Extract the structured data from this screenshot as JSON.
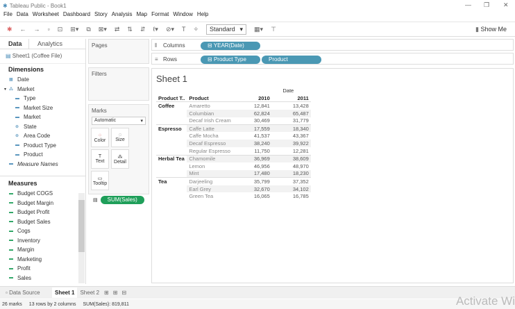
{
  "window": {
    "title": "Tableau Public - Book1"
  },
  "menu": [
    "File",
    "Data",
    "Worksheet",
    "Dashboard",
    "Story",
    "Analysis",
    "Map",
    "Format",
    "Window",
    "Help"
  ],
  "toolbar": {
    "fit": "Standard",
    "show_me": "Show Me"
  },
  "left": {
    "tabs": [
      "Data",
      "Analytics"
    ],
    "datasource": "Sheet1 (Coffee File)",
    "dimensions_label": "Dimensions",
    "dimensions": [
      {
        "n": "Date",
        "i": "cal"
      },
      {
        "n": "Market",
        "i": "hier"
      },
      {
        "n": "Type",
        "i": "abc"
      },
      {
        "n": "Market Size",
        "i": "abc"
      },
      {
        "n": "Market",
        "i": "abc"
      },
      {
        "n": "State",
        "i": "geo"
      },
      {
        "n": "Area Code",
        "i": "geo"
      },
      {
        "n": "Product Type",
        "i": "abc"
      },
      {
        "n": "Product",
        "i": "abc"
      }
    ],
    "measure_names": "Measure Names",
    "measures_label": "Measures",
    "measures": [
      "Budget COGS",
      "Budget Margin",
      "Budget Profit",
      "Budget Sales",
      "Cogs",
      "Inventory",
      "Margin",
      "Marketing",
      "Profit",
      "Sales"
    ]
  },
  "cards": {
    "pages": "Pages",
    "filters": "Filters",
    "marks": "Marks",
    "mark_type": "Automatic",
    "buttons": [
      "Color",
      "Size",
      "Text",
      "Detail",
      "Tooltip"
    ],
    "sum_pill": "SUM(Sales)"
  },
  "shelves": {
    "columns_label": "Columns",
    "rows_label": "Rows",
    "columns": [
      "YEAR(Date)"
    ],
    "rows": [
      "Product Type",
      "Product"
    ]
  },
  "sheet": {
    "title": "Sheet 1",
    "date_header": "Date",
    "col_headers": [
      "Product T..",
      "Product",
      "2010",
      "2011"
    ],
    "rows": [
      {
        "pt": "Coffee",
        "p": "Amaretto",
        "v": [
          "12,841",
          "13,428"
        ]
      },
      {
        "pt": "",
        "p": "Columbian",
        "v": [
          "62,824",
          "65,487"
        ]
      },
      {
        "pt": "",
        "p": "Decaf Irish Cream",
        "v": [
          "30,469",
          "31,779"
        ]
      },
      {
        "pt": "Espresso",
        "p": "Caffe Latte",
        "v": [
          "17,559",
          "18,340"
        ]
      },
      {
        "pt": "",
        "p": "Caffe Mocha",
        "v": [
          "41,537",
          "43,367"
        ]
      },
      {
        "pt": "",
        "p": "Decaf Espresso",
        "v": [
          "38,240",
          "39,922"
        ]
      },
      {
        "pt": "",
        "p": "Regular Espresso",
        "v": [
          "11,750",
          "12,281"
        ]
      },
      {
        "pt": "Herbal Tea",
        "p": "Chamomile",
        "v": [
          "36,969",
          "38,609"
        ]
      },
      {
        "pt": "",
        "p": "Lemon",
        "v": [
          "46,956",
          "48,970"
        ]
      },
      {
        "pt": "",
        "p": "Mint",
        "v": [
          "17,480",
          "18,230"
        ]
      },
      {
        "pt": "Tea",
        "p": "Darjeeling",
        "v": [
          "35,799",
          "37,352"
        ]
      },
      {
        "pt": "",
        "p": "Earl Grey",
        "v": [
          "32,670",
          "34,102"
        ]
      },
      {
        "pt": "",
        "p": "Green Tea",
        "v": [
          "16,065",
          "16,785"
        ]
      }
    ]
  },
  "bottom": {
    "datasource": "Data Source",
    "sheets": [
      "Sheet 1",
      "Sheet 2"
    ]
  },
  "status": {
    "marks": "26 marks",
    "dims": "13 rows by 2 columns",
    "sum": "SUM(Sales): 819,811"
  },
  "watermark": "Activate Wi",
  "colors": {
    "pill": "#4a98b4"
  }
}
